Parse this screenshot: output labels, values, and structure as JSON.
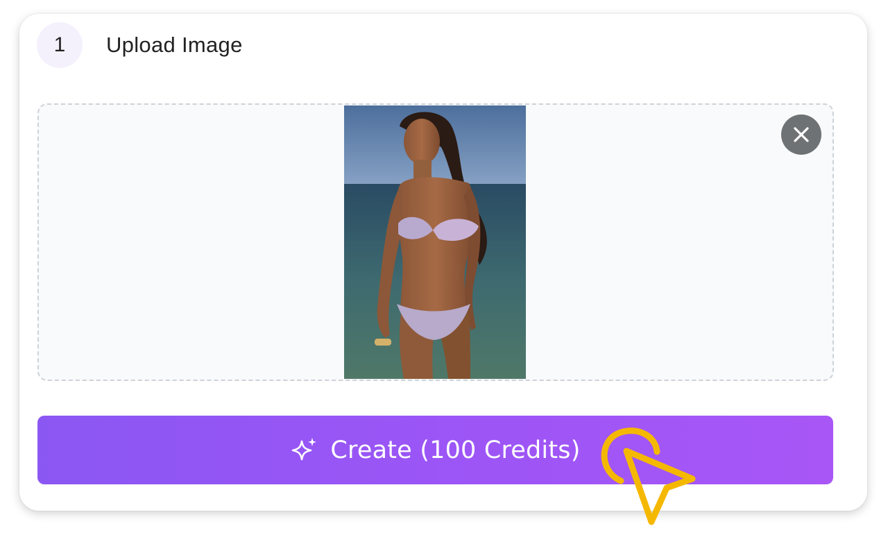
{
  "step": {
    "number": "1",
    "title": "Upload Image"
  },
  "upload": {
    "preview_alt": "Uploaded photo preview",
    "remove_icon": "close-icon"
  },
  "create_button": {
    "label": "Create (100 Credits)",
    "icon": "sparkle-icon"
  },
  "colors": {
    "accent_start": "#8b57f3",
    "accent_end": "#a856f6",
    "step_badge_bg": "#f4f1fd",
    "cursor_highlight": "#f5b800"
  }
}
